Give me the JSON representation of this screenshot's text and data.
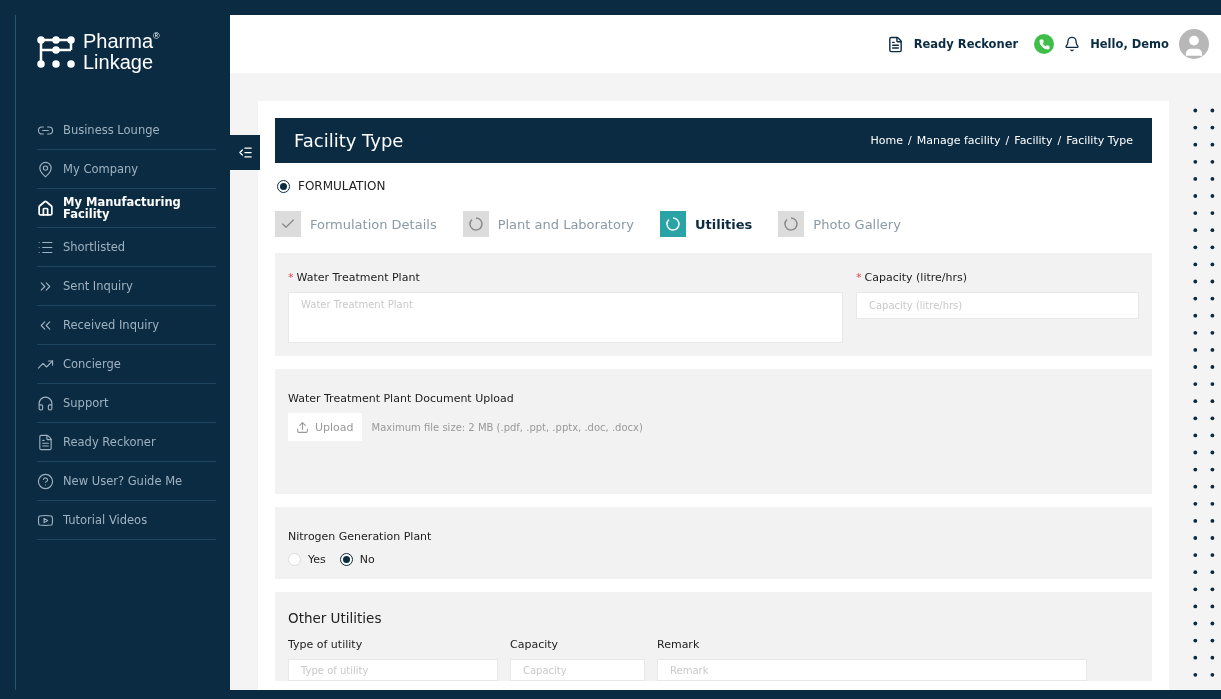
{
  "brand": {
    "line1": "Pharma",
    "line2": "Linkage",
    "mark": "®"
  },
  "sidebar": {
    "items": [
      {
        "label": "Business Lounge",
        "selected": false
      },
      {
        "label": "My Company",
        "selected": false
      },
      {
        "label": "My Manufacturing Facility",
        "selected": true
      },
      {
        "label": "Shortlisted",
        "selected": false
      },
      {
        "label": "Sent Inquiry",
        "selected": false
      },
      {
        "label": "Received Inquiry",
        "selected": false
      },
      {
        "label": "Concierge",
        "selected": false
      },
      {
        "label": "Support",
        "selected": false
      },
      {
        "label": "Ready Reckoner",
        "selected": false
      },
      {
        "label": "New User? Guide Me",
        "selected": false
      },
      {
        "label": "Tutorial Videos",
        "selected": false
      }
    ]
  },
  "header": {
    "reckoner": "Ready Reckoner",
    "greeting": "Hello, Demo"
  },
  "page": {
    "title": "Facility Type",
    "breadcrumb": [
      "Home",
      "Manage facility",
      "Facility",
      "Facility Type"
    ],
    "separator": "/"
  },
  "facility_types": [
    {
      "label": "FORMULATION",
      "selected": true
    }
  ],
  "steps": [
    {
      "label": "Formulation Details",
      "kind": "done",
      "selected": false
    },
    {
      "label": "Plant and Laboratory",
      "kind": "pending",
      "selected": false
    },
    {
      "label": "Utilities",
      "kind": "pending",
      "selected": true
    },
    {
      "label": "Photo Gallery",
      "kind": "pending",
      "selected": false
    }
  ],
  "water": {
    "plant_label": "Water Treatment Plant",
    "plant_placeholder": "Water Treatment Plant",
    "capacity_label": "Capacity (litre/hrs)",
    "capacity_placeholder": "Capacity (litre/hrs)",
    "required": "*"
  },
  "upload": {
    "label": "Water Treatment Plant Document Upload",
    "button": "Upload",
    "hint": "Maximum file size: 2 MB (.pdf, .ppt, .pptx, .doc, .docx)"
  },
  "nitrogen": {
    "label": "Nitrogen Generation Plant",
    "options": [
      {
        "label": "Yes",
        "selected": false
      },
      {
        "label": "No",
        "selected": true
      }
    ]
  },
  "other": {
    "title": "Other Utilities",
    "columns": [
      {
        "label": "Type of utility",
        "placeholder": "Type of utility"
      },
      {
        "label": "Capacity",
        "placeholder": "Capacity"
      },
      {
        "label": "Remark",
        "placeholder": "Remark"
      }
    ]
  }
}
